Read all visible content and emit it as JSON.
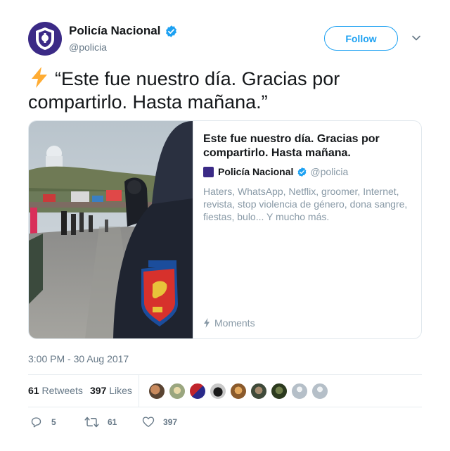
{
  "author": {
    "name": "Policía Nacional",
    "handle": "@policia"
  },
  "follow_label": "Follow",
  "tweet": {
    "emoji": "⚡",
    "text": "“Este fue nuestro día. Gracias por compartirlo. Hasta mañana.”"
  },
  "card": {
    "title": "Este fue nuestro día. Gracias por compartirlo. Hasta mañana.",
    "author_name": "Policía Nacional",
    "author_handle": "@policia",
    "description": "Haters, WhatsApp, Netflix, groomer, Internet, revista, stop violencia de género, dona sangre, fiestas, bulo... Y mucho más.",
    "footer": "Moments"
  },
  "timestamp": "3:00 PM - 30 Aug 2017",
  "stats": {
    "retweets_count": "61",
    "retweets_label": "Retweets",
    "likes_count": "397",
    "likes_label": "Likes"
  },
  "actions": {
    "reply_count": "5",
    "retweet_count": "61",
    "like_count": "397"
  },
  "colors": {
    "accent": "#1da1f2",
    "text": "#14171a",
    "muted": "#657786",
    "border": "#e1e8ed",
    "brand": "#3b2a86"
  },
  "icons": [
    "police-badge-icon",
    "verified-icon",
    "chevron-down-icon",
    "lightning-icon",
    "moments-icon",
    "reply-icon",
    "retweet-icon",
    "like-icon"
  ]
}
